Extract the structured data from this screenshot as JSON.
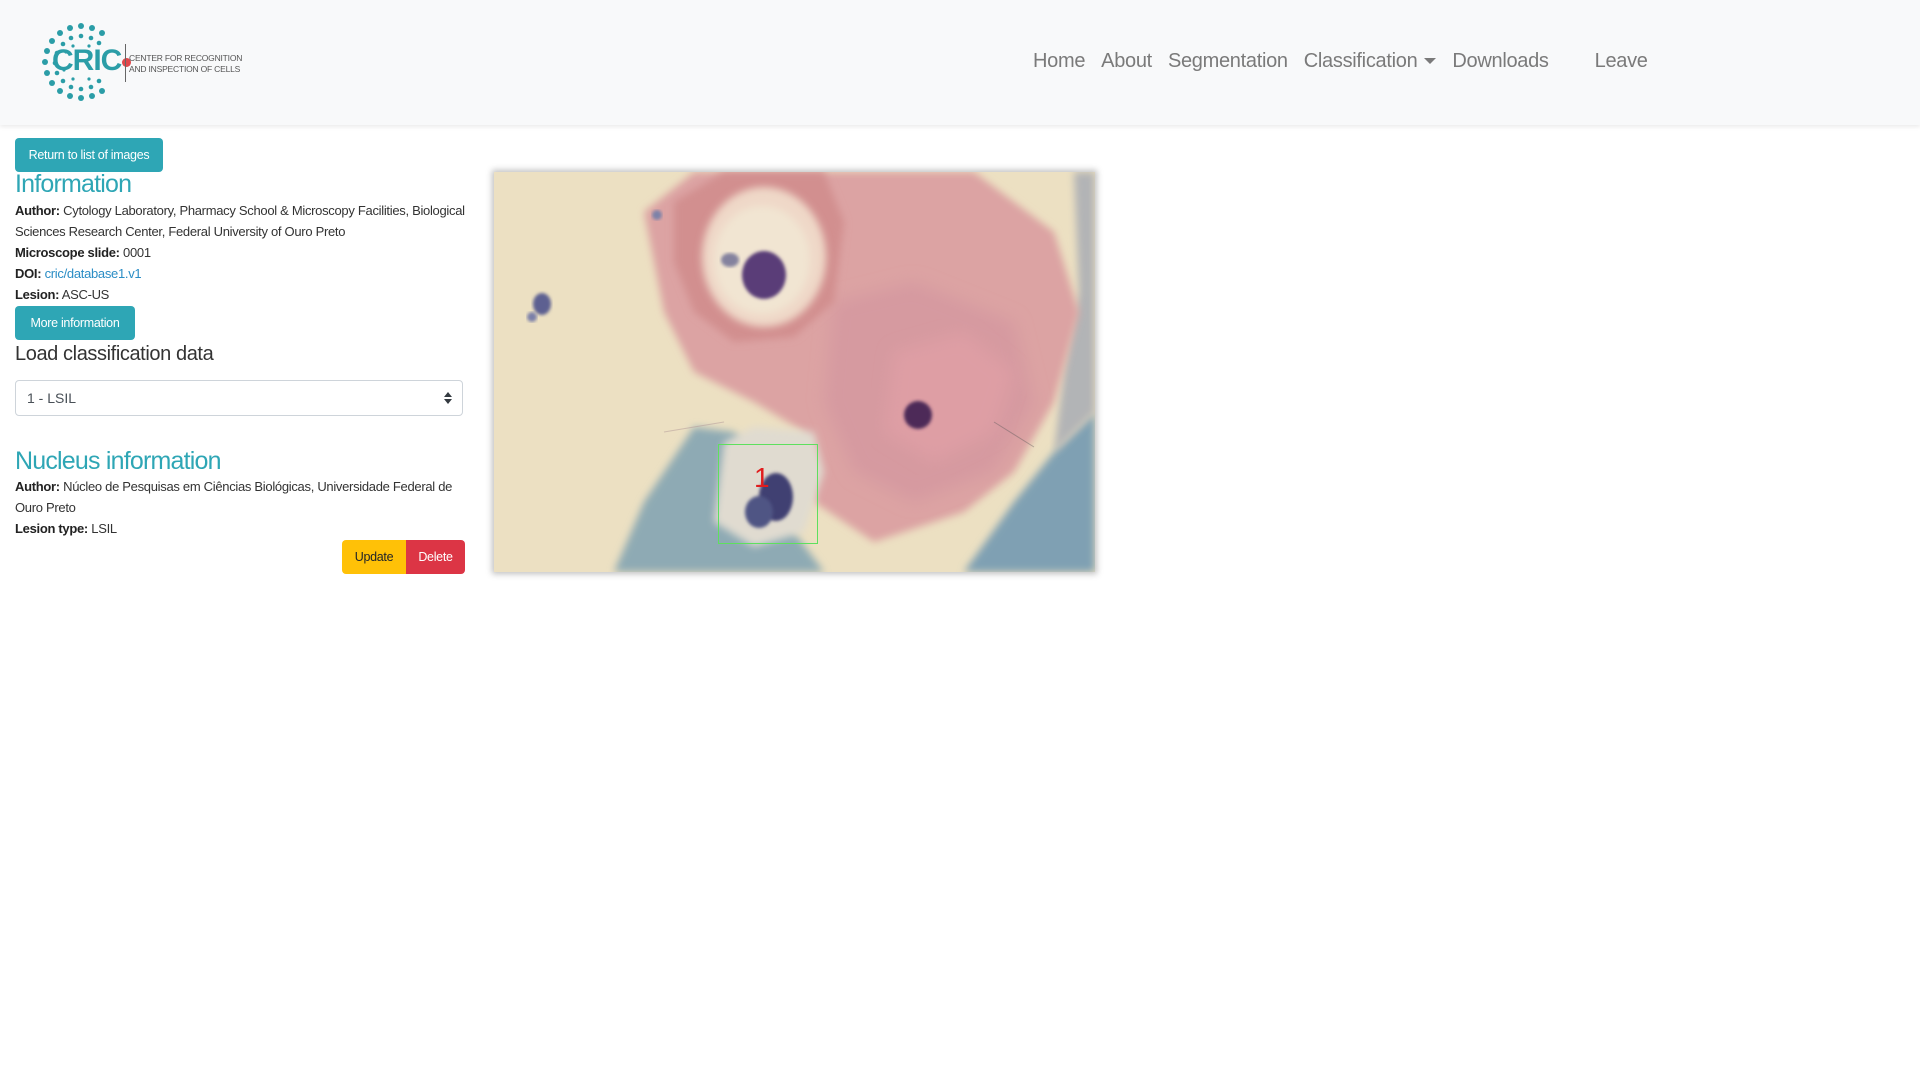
{
  "brand": {
    "logo_text": "CRIC",
    "logo_subtitle_line1": "CENTER FOR RECOGNITION",
    "logo_subtitle_line2": "AND INSPECTION OF CELLS"
  },
  "nav": {
    "home": "Home",
    "about": "About",
    "segmentation": "Segmentation",
    "classification": "Classification",
    "downloads": "Downloads",
    "leave": "Leave"
  },
  "actions": {
    "return_label": "Return to list of images",
    "more_info_label": "More information",
    "update_label": "Update",
    "delete_label": "Delete"
  },
  "information": {
    "heading": "Information",
    "author_label": "Author:",
    "author_value": "Cytology Laboratory, Pharmacy School & Microscopy Facilities, Biological Sciences Research Center, Federal University of Ouro Preto",
    "slide_label": "Microscope slide:",
    "slide_value": "0001",
    "doi_label": "DOI:",
    "doi_value": "cric/database1.v1",
    "lesion_label": "Lesion:",
    "lesion_value": "ASC-US"
  },
  "load_classification": {
    "heading": "Load classification data",
    "selected_value": "1 - LSIL"
  },
  "nucleus": {
    "heading": "Nucleus information",
    "author_label": "Author:",
    "author_value": "Núcleo de Pesquisas em Ciências Biológicas, Universidade Federal de Ouro Preto",
    "lesion_type_label": "Lesion type:",
    "lesion_type_value": "LSIL"
  },
  "image": {
    "roi_label": "1",
    "roi_color": "#5ee05e",
    "roi_label_color": "#e11d1d"
  },
  "colors": {
    "info": "#2ea6b5",
    "warning": "#ffc107",
    "danger": "#dc3545",
    "navbar_bg": "#f8f9fa"
  }
}
